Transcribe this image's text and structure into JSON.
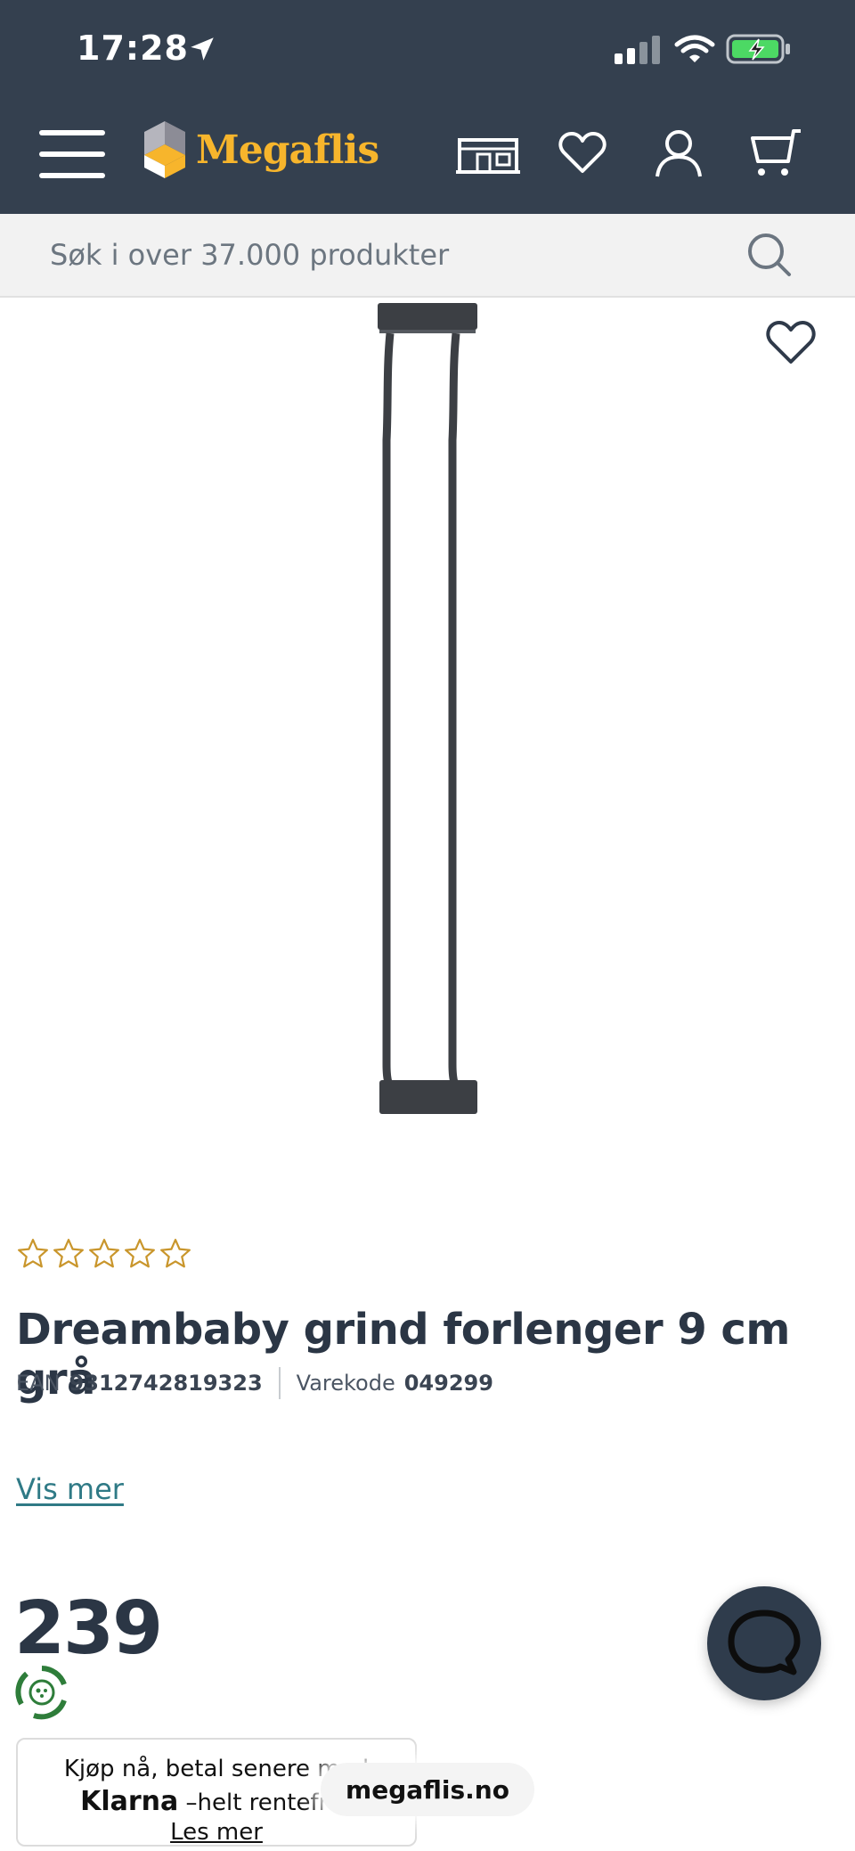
{
  "status_bar": {
    "time": "17:28"
  },
  "header": {
    "logo_text": "Megaflis"
  },
  "search": {
    "placeholder": "Søk i over 37.000 produkter"
  },
  "product": {
    "rating": 0,
    "rating_max": 5,
    "title": "Dreambaby grind forlenger 9 cm grå",
    "ean_label": "EAN",
    "ean_value": "9312742819323",
    "code_label": "Varekode",
    "code_value": "049299",
    "more_link": "Vis mer",
    "price": "239"
  },
  "klarna": {
    "line1": "Kjøp nå, betal senere med",
    "brand": "Klarna",
    "line2": "–helt rentefritt",
    "link": "Les mer"
  },
  "browser": {
    "url": "megaflis.no"
  },
  "colors": {
    "header_bg": "#34404f",
    "logo": "#f7b52c",
    "link": "#2f7a86",
    "star": "#c9962c"
  }
}
